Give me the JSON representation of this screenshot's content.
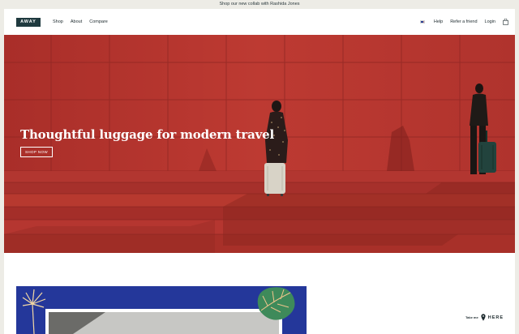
{
  "announcement": {
    "text": "Shop our new collab with Rashida Jones"
  },
  "header": {
    "logo": "AWAY",
    "nav_left": [
      {
        "label": "Shop"
      },
      {
        "label": "About"
      },
      {
        "label": "Compare"
      }
    ],
    "nav_right": [
      {
        "label": "Help"
      },
      {
        "label": "Refer a friend"
      },
      {
        "label": "Login"
      }
    ],
    "locale_icon": "us-flag-icon",
    "cart_icon": "shopping-bag-icon"
  },
  "hero": {
    "title": "Thoughtful luggage for modern travel",
    "cta_label": "SHOP NOW"
  },
  "floating_widget": {
    "small_text": "Take me",
    "big_text": "HERE",
    "icon": "map-pin-icon"
  },
  "colors": {
    "brand_dark": "#1f3a3f",
    "hero_red": "#b8352f",
    "promo_blue": "#24379a",
    "page_bg": "#edece6"
  }
}
